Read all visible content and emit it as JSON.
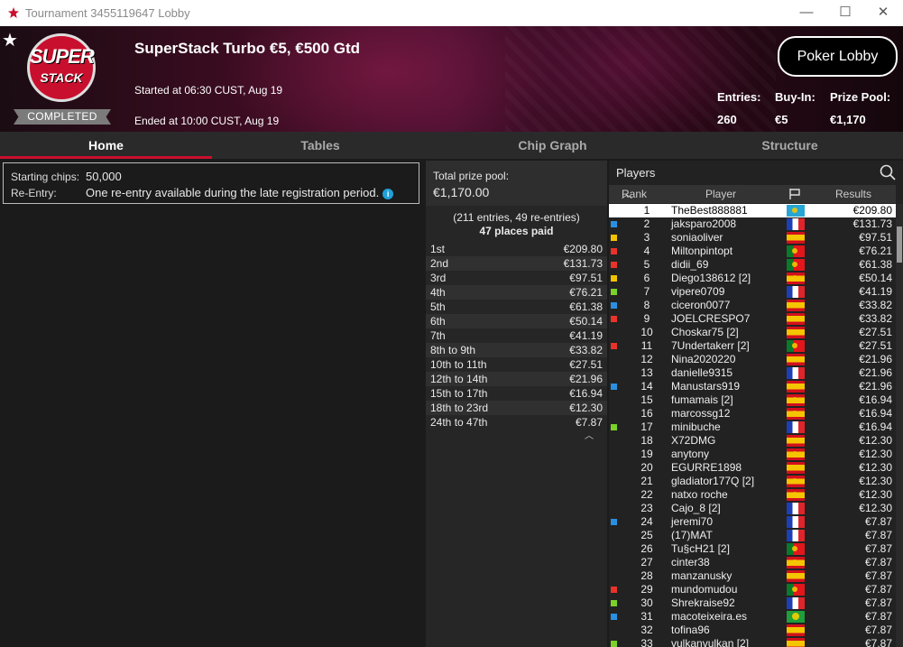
{
  "window": {
    "title": "Tournament 3455119647 Lobby",
    "controls": [
      "—",
      "☐",
      "✕"
    ]
  },
  "header": {
    "badge_top": "SUPER",
    "badge_bottom": "STACK",
    "status": "COMPLETED",
    "title": "SuperStack Turbo €5, €500 Gtd",
    "started": "Started at 06:30 CUST, Aug 19",
    "ended": "Ended at 10:00 CUST, Aug 19",
    "lobby_button": "Poker Lobby",
    "entries_label": "Entries:",
    "entries_value": "260",
    "buyin_label": "Buy-In:",
    "buyin_value": "€5",
    "prizepool_label": "Prize Pool:",
    "prizepool_value": "€1,170"
  },
  "tabs": [
    "Home",
    "Tables",
    "Chip Graph",
    "Structure"
  ],
  "info": {
    "chips_label": "Starting chips:",
    "chips_value": "50,000",
    "reentry_label": "Re-Entry:",
    "reentry_value": "One re-entry available during the late registration period."
  },
  "prizes": {
    "total_label": "Total prize pool:",
    "total_value": "€1,170.00",
    "entries_note": "(211 entries, 49 re-entries)",
    "places_paid": "47 places paid",
    "rows": [
      {
        "place": "1st",
        "amount": "€209.80"
      },
      {
        "place": "2nd",
        "amount": "€131.73"
      },
      {
        "place": "3rd",
        "amount": "€97.51"
      },
      {
        "place": "4th",
        "amount": "€76.21"
      },
      {
        "place": "5th",
        "amount": "€61.38"
      },
      {
        "place": "6th",
        "amount": "€50.14"
      },
      {
        "place": "7th",
        "amount": "€41.19"
      },
      {
        "place": "8th to 9th",
        "amount": "€33.82"
      },
      {
        "place": "10th to 11th",
        "amount": "€27.51"
      },
      {
        "place": "12th to 14th",
        "amount": "€21.96"
      },
      {
        "place": "15th to 17th",
        "amount": "€16.94"
      },
      {
        "place": "18th to 23rd",
        "amount": "€12.30"
      },
      {
        "place": "24th to 47th",
        "amount": "€7.87"
      }
    ]
  },
  "players": {
    "title": "Players",
    "col_rank": "Rank",
    "col_player": "Player",
    "col_results": "Results",
    "rows": [
      {
        "rank": "1",
        "name": "TheBest888881",
        "flag": "kz",
        "result": "€209.80",
        "tag": ""
      },
      {
        "rank": "2",
        "name": "jaksparo2008",
        "flag": "fr",
        "result": "€131.73",
        "tag": "#2a8fe0"
      },
      {
        "rank": "3",
        "name": "soniaoliver",
        "flag": "es",
        "result": "€97.51",
        "tag": "#f2c200"
      },
      {
        "rank": "4",
        "name": "Miltonpintopt",
        "flag": "pt",
        "result": "€76.21",
        "tag": "#e8332a"
      },
      {
        "rank": "5",
        "name": "didii_69",
        "flag": "pt",
        "result": "€61.38",
        "tag": "#e8332a"
      },
      {
        "rank": "6",
        "name": "Diego138612 [2]",
        "flag": "es",
        "result": "€50.14",
        "tag": "#f2c200"
      },
      {
        "rank": "7",
        "name": "vipere0709",
        "flag": "fr",
        "result": "€41.19",
        "tag": "#7ad12a"
      },
      {
        "rank": "8",
        "name": "ciceron0077",
        "flag": "es",
        "result": "€33.82",
        "tag": "#2a8fe0"
      },
      {
        "rank": "9",
        "name": "JOELCRESPO7",
        "flag": "es",
        "result": "€33.82",
        "tag": "#e8332a"
      },
      {
        "rank": "10",
        "name": "Choskar75 [2]",
        "flag": "es",
        "result": "€27.51",
        "tag": ""
      },
      {
        "rank": "11",
        "name": "7Undertakerr [2]",
        "flag": "pt",
        "result": "€27.51",
        "tag": "#e8332a"
      },
      {
        "rank": "12",
        "name": "Nina2020220",
        "flag": "es",
        "result": "€21.96",
        "tag": ""
      },
      {
        "rank": "13",
        "name": "danielle9315",
        "flag": "fr",
        "result": "€21.96",
        "tag": ""
      },
      {
        "rank": "14",
        "name": "Manustars919",
        "flag": "es",
        "result": "€21.96",
        "tag": "#2a8fe0"
      },
      {
        "rank": "15",
        "name": "fumamais [2]",
        "flag": "es",
        "result": "€16.94",
        "tag": ""
      },
      {
        "rank": "16",
        "name": "marcossg12",
        "flag": "es",
        "result": "€16.94",
        "tag": ""
      },
      {
        "rank": "17",
        "name": "minibuche",
        "flag": "fr",
        "result": "€16.94",
        "tag": "#7ad12a"
      },
      {
        "rank": "18",
        "name": "X72DMG",
        "flag": "es",
        "result": "€12.30",
        "tag": ""
      },
      {
        "rank": "19",
        "name": "anytony",
        "flag": "es",
        "result": "€12.30",
        "tag": ""
      },
      {
        "rank": "20",
        "name": "EGURRE1898",
        "flag": "es",
        "result": "€12.30",
        "tag": ""
      },
      {
        "rank": "21",
        "name": "gladiator177Q [2]",
        "flag": "es",
        "result": "€12.30",
        "tag": ""
      },
      {
        "rank": "22",
        "name": "natxo roche",
        "flag": "es",
        "result": "€12.30",
        "tag": ""
      },
      {
        "rank": "23",
        "name": "Cajo_8 [2]",
        "flag": "fr",
        "result": "€12.30",
        "tag": ""
      },
      {
        "rank": "24",
        "name": "jeremi70",
        "flag": "fr",
        "result": "€7.87",
        "tag": "#2a8fe0"
      },
      {
        "rank": "25",
        "name": "(17)MAT",
        "flag": "fr",
        "result": "€7.87",
        "tag": ""
      },
      {
        "rank": "26",
        "name": "Tu§cH21 [2]",
        "flag": "pt",
        "result": "€7.87",
        "tag": ""
      },
      {
        "rank": "27",
        "name": "cinter38",
        "flag": "es",
        "result": "€7.87",
        "tag": ""
      },
      {
        "rank": "28",
        "name": "manzanusky",
        "flag": "es",
        "result": "€7.87",
        "tag": ""
      },
      {
        "rank": "29",
        "name": "mundomudou",
        "flag": "pt",
        "result": "€7.87",
        "tag": "#e8332a"
      },
      {
        "rank": "30",
        "name": "Shrekraise92",
        "flag": "fr",
        "result": "€7.87",
        "tag": "#7ad12a"
      },
      {
        "rank": "31",
        "name": "macoteixeira.es",
        "flag": "br",
        "result": "€7.87",
        "tag": "#2a8fe0"
      },
      {
        "rank": "32",
        "name": "tofina96",
        "flag": "es",
        "result": "€7.87",
        "tag": ""
      },
      {
        "rank": "33",
        "name": "vulkanvulkan [2]",
        "flag": "es",
        "result": "€7.87",
        "tag": "#7ad12a"
      }
    ]
  },
  "colors": {
    "accent": "#c8102e",
    "badge_grey": "#7b7b7b"
  }
}
